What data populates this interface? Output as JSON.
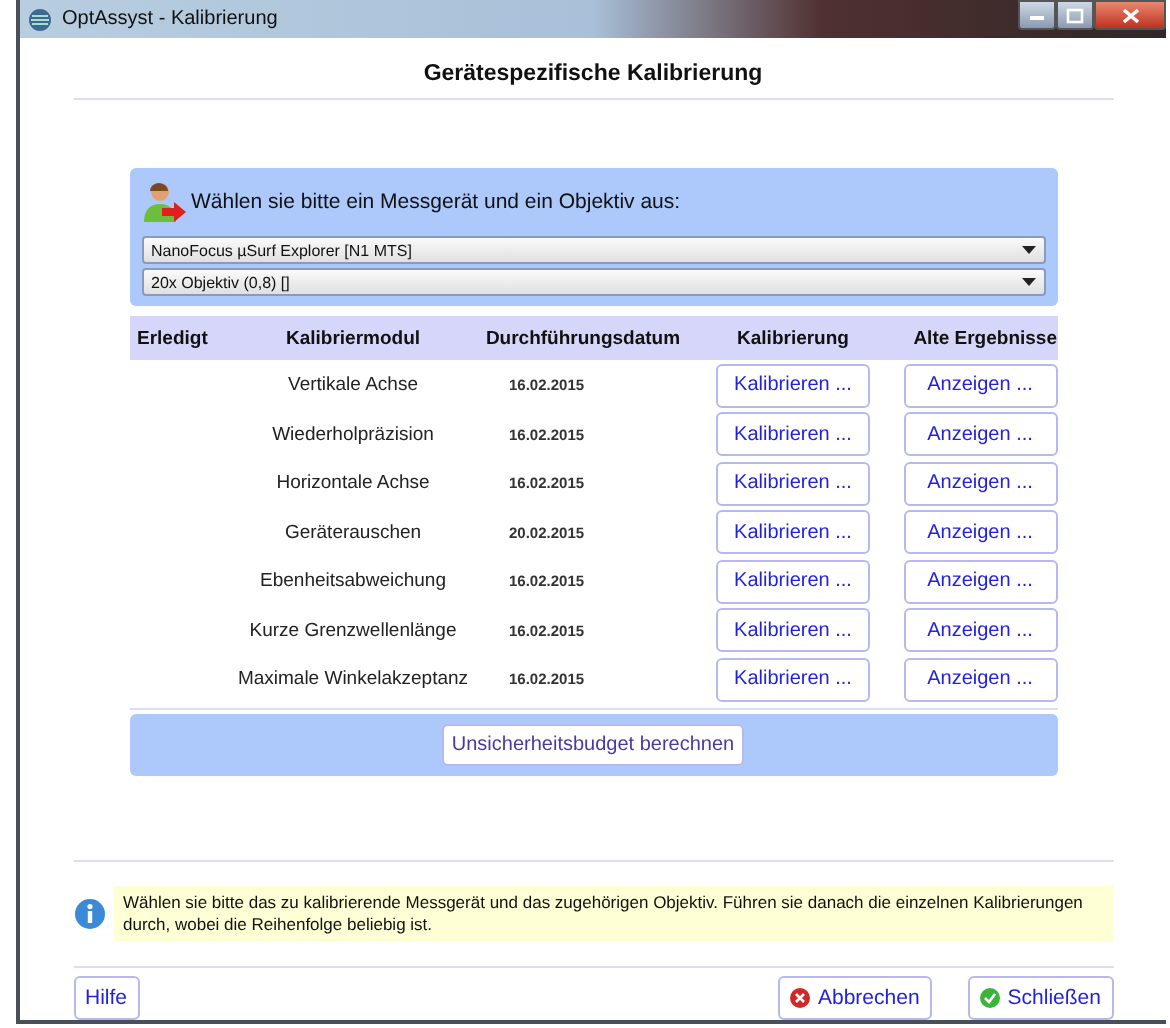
{
  "window": {
    "title": "OptAssyst - Kalibrierung"
  },
  "heading": "Gerätespezifische Kalibrierung",
  "selection": {
    "prompt": "Wählen sie bitte ein Messgerät und ein Objektiv aus:",
    "device": "NanoFocus µSurf Explorer  [N1 MTS]",
    "objective": "20x Objektiv (0,8)  []"
  },
  "table": {
    "columns": [
      "Erledigt",
      "Kalibriermodul",
      "Durchführungsdatum",
      "Kalibrierung",
      "Alte Ergebnisse"
    ],
    "rows": [
      {
        "module": "Vertikale Achse",
        "date": "16.02.2015",
        "calibrate": "Kalibrieren ...",
        "show": "Anzeigen ..."
      },
      {
        "module": "Wiederholpräzision",
        "date": "16.02.2015",
        "calibrate": "Kalibrieren ...",
        "show": "Anzeigen ..."
      },
      {
        "module": "Horizontale Achse",
        "date": "16.02.2015",
        "calibrate": "Kalibrieren ...",
        "show": "Anzeigen ..."
      },
      {
        "module": "Geräterauschen",
        "date": "20.02.2015",
        "calibrate": "Kalibrieren ...",
        "show": "Anzeigen ..."
      },
      {
        "module": "Ebenheitsabweichung",
        "date": "16.02.2015",
        "calibrate": "Kalibrieren ...",
        "show": "Anzeigen ..."
      },
      {
        "module": "Kurze Grenzwellenlänge",
        "date": "16.02.2015",
        "calibrate": "Kalibrieren ...",
        "show": "Anzeigen ..."
      },
      {
        "module": "Maximale Winkelakzeptanz",
        "date": "16.02.2015",
        "calibrate": "Kalibrieren ...",
        "show": "Anzeigen ..."
      }
    ]
  },
  "budget_button": "Unsicherheitsbudget berechnen",
  "info": "Wählen sie bitte das zu kalibrierende Messgerät und das zugehörigen Objektiv. Führen sie danach die einzelnen Kalibrierungen durch, wobei die Reihenfolge beliebig ist.",
  "buttons": [
    {
      "label": "Hilfe",
      "kind": "plain"
    },
    {
      "label": "Abbrechen",
      "kind": "cancel"
    },
    {
      "label": "Schließen",
      "kind": "ok"
    }
  ]
}
